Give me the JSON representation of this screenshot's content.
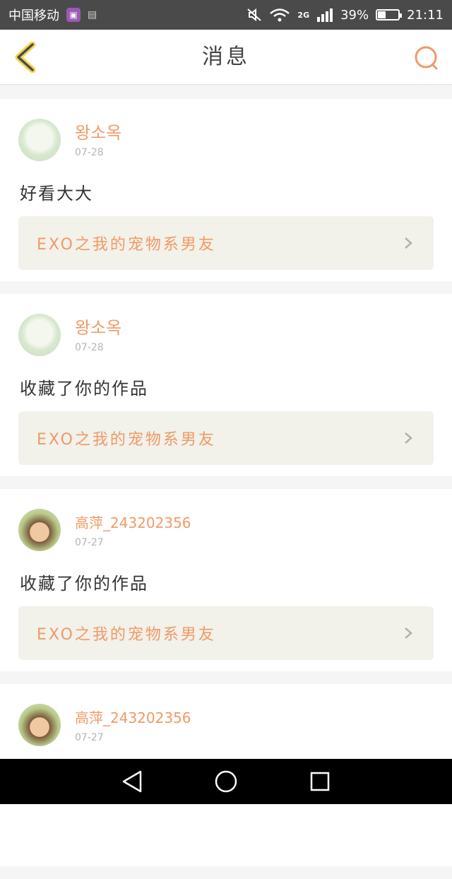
{
  "status_bar": {
    "carrier": "中国移动",
    "network": "2G",
    "battery_percent_label": "39%",
    "battery_level": 0.39,
    "time": "21:11"
  },
  "header": {
    "title": "消息",
    "back_icon": "chevron-left-icon",
    "search_icon": "search-icon"
  },
  "colors": {
    "accent": "#f09a66",
    "card_link_bg": "#f2f1ea",
    "status_bar_bg": "#4a4a4a"
  },
  "messages": [
    {
      "username": "왕소옥",
      "date": "07-28",
      "text": "好看大大",
      "work_title": "EXO之我的宠物系男友"
    },
    {
      "username": "왕소옥",
      "date": "07-28",
      "text": "收藏了你的作品",
      "work_title": "EXO之我的宠物系男友"
    },
    {
      "username": "高萍_243202356",
      "date": "07-27",
      "text": "收藏了你的作品",
      "work_title": "EXO之我的宠物系男友"
    },
    {
      "username": "高萍_243202356",
      "date": "07-27"
    }
  ],
  "nav_bar": {
    "back": "triangle-back-icon",
    "home": "circle-home-icon",
    "recent": "square-recent-icon"
  }
}
